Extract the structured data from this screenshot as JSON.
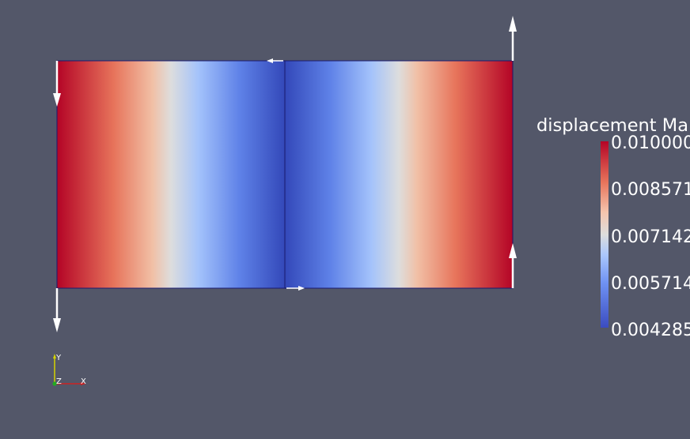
{
  "scalar_bar": {
    "title": "displacement Ma",
    "labels": [
      "0.010000",
      "0.008571",
      "0.007142",
      "0.005714",
      "0.004285"
    ]
  },
  "axes": {
    "x": "X",
    "y": "Y",
    "z": "Z"
  },
  "colors": {
    "background": "#535769",
    "colormap_high": "#b40426",
    "colormap_mid": "#dddddd",
    "colormap_low": "#3b4cc0",
    "outline": "#1a1a6e",
    "arrow": "#ffffff"
  }
}
